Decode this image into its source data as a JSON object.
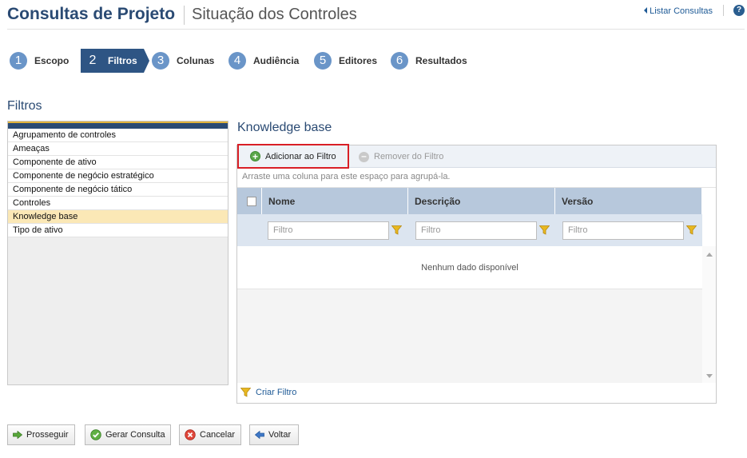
{
  "header": {
    "title": "Consultas de Projeto",
    "subtitle": "Situação dos Controles",
    "list_link": "Listar Consultas",
    "help_glyph": "?"
  },
  "steps": [
    {
      "num": "1",
      "label": "Escopo",
      "active": false
    },
    {
      "num": "2",
      "label": "Filtros",
      "active": true
    },
    {
      "num": "3",
      "label": "Colunas",
      "active": false
    },
    {
      "num": "4",
      "label": "Audiência",
      "active": false
    },
    {
      "num": "5",
      "label": "Editores",
      "active": false
    },
    {
      "num": "6",
      "label": "Resultados",
      "active": false
    }
  ],
  "filters": {
    "title": "Filtros",
    "items": [
      "Agrupamento de controles",
      "Ameaças",
      "Componente de ativo",
      "Componente de negócio estratégico",
      "Componente de negócio tático",
      "Controles",
      "Knowledge base",
      "Tipo de ativo"
    ],
    "selected": "Knowledge base"
  },
  "grid": {
    "title": "Knowledge base",
    "add_label": "Adicionar ao Filtro",
    "remove_label": "Remover do Filtro",
    "group_hint": "Arraste uma coluna para este espaço para agrupá-la.",
    "columns": [
      "Nome",
      "Descrição",
      "Versão"
    ],
    "filter_placeholder": "Filtro",
    "no_data": "Nenhum dado disponível",
    "create_filter": "Criar Filtro"
  },
  "actions": {
    "proceed": "Prosseguir",
    "generate": "Gerar Consulta",
    "cancel": "Cancelar",
    "back": "Voltar"
  },
  "colors": {
    "primary": "#2a4a73",
    "active_step": "#2e5584",
    "step_circle": "#6a95c8",
    "selected_row": "#fbe8b6",
    "highlight_border": "#d91f26",
    "link": "#1e5a96"
  },
  "icons": {
    "help": "help-icon",
    "add": "plus-circle-icon",
    "remove": "minus-circle-icon",
    "filter": "funnel-icon",
    "proceed": "arrow-right-icon",
    "generate": "check-circle-icon",
    "cancel": "x-circle-icon",
    "back": "arrow-left-icon"
  }
}
